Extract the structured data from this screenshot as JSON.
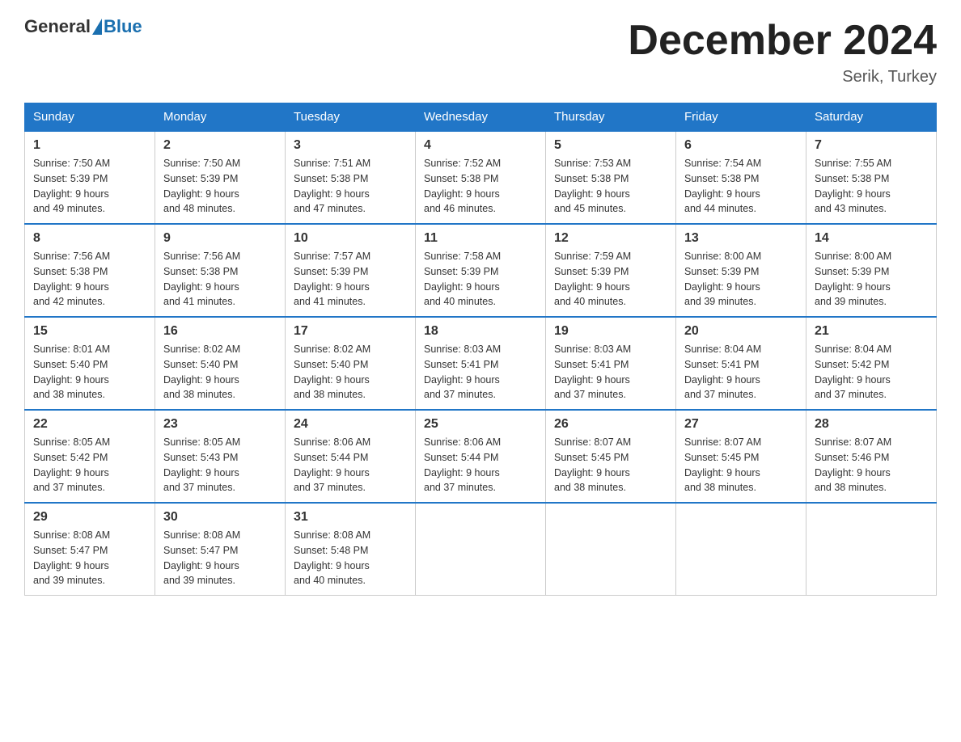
{
  "logo": {
    "general": "General",
    "blue": "Blue"
  },
  "title": "December 2024",
  "location": "Serik, Turkey",
  "days_of_week": [
    "Sunday",
    "Monday",
    "Tuesday",
    "Wednesday",
    "Thursday",
    "Friday",
    "Saturday"
  ],
  "weeks": [
    [
      {
        "day": "1",
        "sunrise": "7:50 AM",
        "sunset": "5:39 PM",
        "daylight": "9 hours and 49 minutes."
      },
      {
        "day": "2",
        "sunrise": "7:50 AM",
        "sunset": "5:39 PM",
        "daylight": "9 hours and 48 minutes."
      },
      {
        "day": "3",
        "sunrise": "7:51 AM",
        "sunset": "5:38 PM",
        "daylight": "9 hours and 47 minutes."
      },
      {
        "day": "4",
        "sunrise": "7:52 AM",
        "sunset": "5:38 PM",
        "daylight": "9 hours and 46 minutes."
      },
      {
        "day": "5",
        "sunrise": "7:53 AM",
        "sunset": "5:38 PM",
        "daylight": "9 hours and 45 minutes."
      },
      {
        "day": "6",
        "sunrise": "7:54 AM",
        "sunset": "5:38 PM",
        "daylight": "9 hours and 44 minutes."
      },
      {
        "day": "7",
        "sunrise": "7:55 AM",
        "sunset": "5:38 PM",
        "daylight": "9 hours and 43 minutes."
      }
    ],
    [
      {
        "day": "8",
        "sunrise": "7:56 AM",
        "sunset": "5:38 PM",
        "daylight": "9 hours and 42 minutes."
      },
      {
        "day": "9",
        "sunrise": "7:56 AM",
        "sunset": "5:38 PM",
        "daylight": "9 hours and 41 minutes."
      },
      {
        "day": "10",
        "sunrise": "7:57 AM",
        "sunset": "5:39 PM",
        "daylight": "9 hours and 41 minutes."
      },
      {
        "day": "11",
        "sunrise": "7:58 AM",
        "sunset": "5:39 PM",
        "daylight": "9 hours and 40 minutes."
      },
      {
        "day": "12",
        "sunrise": "7:59 AM",
        "sunset": "5:39 PM",
        "daylight": "9 hours and 40 minutes."
      },
      {
        "day": "13",
        "sunrise": "8:00 AM",
        "sunset": "5:39 PM",
        "daylight": "9 hours and 39 minutes."
      },
      {
        "day": "14",
        "sunrise": "8:00 AM",
        "sunset": "5:39 PM",
        "daylight": "9 hours and 39 minutes."
      }
    ],
    [
      {
        "day": "15",
        "sunrise": "8:01 AM",
        "sunset": "5:40 PM",
        "daylight": "9 hours and 38 minutes."
      },
      {
        "day": "16",
        "sunrise": "8:02 AM",
        "sunset": "5:40 PM",
        "daylight": "9 hours and 38 minutes."
      },
      {
        "day": "17",
        "sunrise": "8:02 AM",
        "sunset": "5:40 PM",
        "daylight": "9 hours and 38 minutes."
      },
      {
        "day": "18",
        "sunrise": "8:03 AM",
        "sunset": "5:41 PM",
        "daylight": "9 hours and 37 minutes."
      },
      {
        "day": "19",
        "sunrise": "8:03 AM",
        "sunset": "5:41 PM",
        "daylight": "9 hours and 37 minutes."
      },
      {
        "day": "20",
        "sunrise": "8:04 AM",
        "sunset": "5:41 PM",
        "daylight": "9 hours and 37 minutes."
      },
      {
        "day": "21",
        "sunrise": "8:04 AM",
        "sunset": "5:42 PM",
        "daylight": "9 hours and 37 minutes."
      }
    ],
    [
      {
        "day": "22",
        "sunrise": "8:05 AM",
        "sunset": "5:42 PM",
        "daylight": "9 hours and 37 minutes."
      },
      {
        "day": "23",
        "sunrise": "8:05 AM",
        "sunset": "5:43 PM",
        "daylight": "9 hours and 37 minutes."
      },
      {
        "day": "24",
        "sunrise": "8:06 AM",
        "sunset": "5:44 PM",
        "daylight": "9 hours and 37 minutes."
      },
      {
        "day": "25",
        "sunrise": "8:06 AM",
        "sunset": "5:44 PM",
        "daylight": "9 hours and 37 minutes."
      },
      {
        "day": "26",
        "sunrise": "8:07 AM",
        "sunset": "5:45 PM",
        "daylight": "9 hours and 38 minutes."
      },
      {
        "day": "27",
        "sunrise": "8:07 AM",
        "sunset": "5:45 PM",
        "daylight": "9 hours and 38 minutes."
      },
      {
        "day": "28",
        "sunrise": "8:07 AM",
        "sunset": "5:46 PM",
        "daylight": "9 hours and 38 minutes."
      }
    ],
    [
      {
        "day": "29",
        "sunrise": "8:08 AM",
        "sunset": "5:47 PM",
        "daylight": "9 hours and 39 minutes."
      },
      {
        "day": "30",
        "sunrise": "8:08 AM",
        "sunset": "5:47 PM",
        "daylight": "9 hours and 39 minutes."
      },
      {
        "day": "31",
        "sunrise": "8:08 AM",
        "sunset": "5:48 PM",
        "daylight": "9 hours and 40 minutes."
      },
      null,
      null,
      null,
      null
    ]
  ],
  "labels": {
    "sunrise": "Sunrise:",
    "sunset": "Sunset:",
    "daylight": "Daylight:"
  }
}
